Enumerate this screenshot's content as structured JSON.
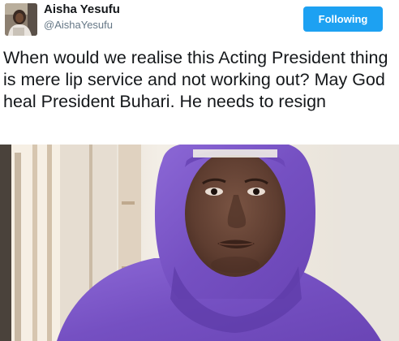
{
  "tweet": {
    "author": {
      "display_name": "Aisha Yesufu",
      "handle": "@AishaYesufu",
      "avatar_icon": "profile-photo-avatar"
    },
    "follow_button_label": "Following",
    "text": "When would we realise this Acting President thing is mere lip service and not working out? May God heal President Buhari. He needs to resign",
    "media": {
      "type": "video-still",
      "description_icon": "woman-in-purple-hijab-photo"
    }
  },
  "colors": {
    "accent": "#1da1f2",
    "text_primary": "#14171a",
    "text_secondary": "#657786",
    "hijab_purple": "#7d57c9"
  }
}
